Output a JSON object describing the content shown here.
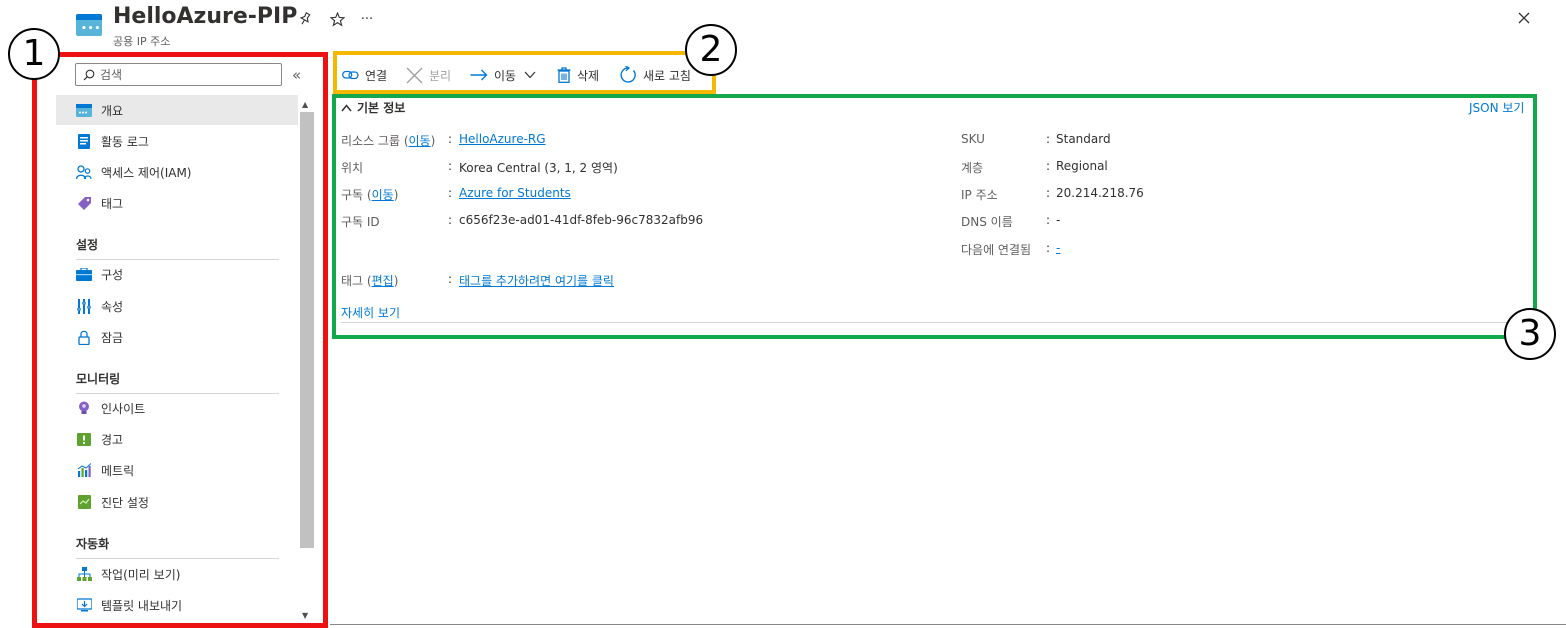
{
  "header": {
    "title": "HelloAzure-PIP",
    "subtitle": "공용 IP 주소",
    "more": "···"
  },
  "annotations": [
    "1",
    "2",
    "3"
  ],
  "sidebar": {
    "search_placeholder": "검색",
    "collapse": "«",
    "items": [
      {
        "label": "개요",
        "icon": "overview-icon",
        "active": true
      },
      {
        "label": "활동 로그",
        "icon": "activity-log-icon"
      },
      {
        "label": "액세스 제어(IAM)",
        "icon": "access-control-icon"
      },
      {
        "label": "태그",
        "icon": "tag-icon"
      },
      {
        "label": "구성",
        "icon": "configuration-icon"
      },
      {
        "label": "속성",
        "icon": "properties-icon"
      },
      {
        "label": "잠금",
        "icon": "lock-icon"
      },
      {
        "label": "인사이트",
        "icon": "insights-icon"
      },
      {
        "label": "경고",
        "icon": "alerts-icon"
      },
      {
        "label": "메트릭",
        "icon": "metrics-icon"
      },
      {
        "label": "진단 설정",
        "icon": "diagnostic-settings-icon"
      },
      {
        "label": "작업(미리 보기)",
        "icon": "tasks-icon"
      },
      {
        "label": "템플릿 내보내기",
        "icon": "export-template-icon"
      }
    ],
    "sections": {
      "settings": "설정",
      "monitoring": "모니터링",
      "automation": "자동화"
    }
  },
  "toolbar": {
    "associate": "연결",
    "dissociate": "분리",
    "move": "이동",
    "delete": "삭제",
    "refresh": "새로 고침"
  },
  "essentials": {
    "title": "기본 정보",
    "json_view": "JSON 보기",
    "more": "자세히 보기",
    "left": {
      "resource_group_label": "리소스 그룹",
      "resource_group_move": "이동",
      "resource_group_value": "HelloAzure-RG",
      "location_label": "위치",
      "location_value": "Korea Central (3, 1, 2 영역)",
      "subscription_label": "구독",
      "subscription_move": "이동",
      "subscription_value": "Azure for Students",
      "subscription_id_label": "구독 ID",
      "subscription_id_value": "c656f23e-ad01-41df-8feb-96c7832afb96",
      "tags_label": "태그",
      "tags_edit": "편집",
      "tags_value": "태그를 추가하려면 여기를 클릭"
    },
    "right": {
      "sku_label": "SKU",
      "sku_value": "Standard",
      "tier_label": "계층",
      "tier_value": "Regional",
      "ip_label": "IP 주소",
      "ip_value": "20.214.218.76",
      "dns_label": "DNS 이름",
      "dns_value": "-",
      "associated_label": "다음에 연결됨",
      "associated_value": "-"
    }
  },
  "colors": {
    "link": "#0078d4",
    "red_box": "#ee1111",
    "yellow_box": "#f5b800",
    "green_box": "#13a84a"
  }
}
